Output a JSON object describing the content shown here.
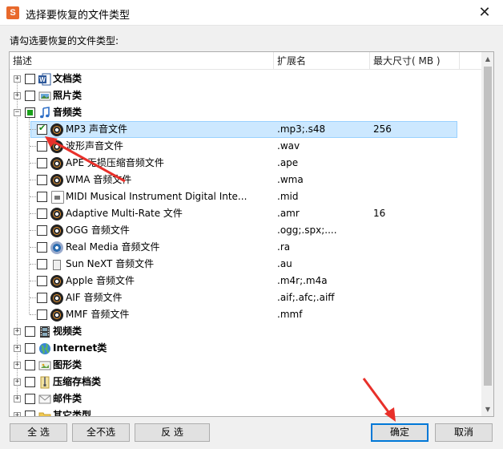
{
  "window": {
    "title": "选择要恢复的文件类型",
    "app_icon_letter": "S",
    "close_glyph": "✕"
  },
  "prompt": "请勾选要恢复的文件类型:",
  "columns": {
    "description": "描述",
    "extension": "扩展名",
    "max_size": "最大尺寸( MB )"
  },
  "tree": {
    "categories": [
      {
        "label": "文档类",
        "icon": "word-doc-icon",
        "expander": "+",
        "check_state": "unchecked"
      },
      {
        "label": "照片类",
        "icon": "photo-icon",
        "expander": "+",
        "check_state": "unchecked"
      },
      {
        "label": "音频类",
        "icon": "music-note-icon",
        "expander": "−",
        "check_state": "partial"
      },
      {
        "label": "视频类",
        "icon": "film-icon",
        "expander": "+",
        "check_state": "unchecked"
      },
      {
        "label": "Internet类",
        "icon": "globe-icon",
        "expander": "+",
        "check_state": "unchecked"
      },
      {
        "label": "图形类",
        "icon": "image-icon",
        "expander": "+",
        "check_state": "unchecked"
      },
      {
        "label": "压缩存档类",
        "icon": "archive-icon",
        "expander": "+",
        "check_state": "unchecked"
      },
      {
        "label": "邮件类",
        "icon": "envelope-icon",
        "expander": "+",
        "check_state": "unchecked"
      },
      {
        "label": "其它类型",
        "icon": "folder-icon",
        "expander": "+",
        "check_state": "unchecked"
      }
    ],
    "audio_items": [
      {
        "label": "MP3 声音文件",
        "ext": ".mp3;.s48",
        "size": "256",
        "checked": true,
        "selected": true,
        "icon": "audio-disc-icon"
      },
      {
        "label": "波形声音文件",
        "ext": ".wav",
        "size": "",
        "checked": false,
        "icon": "audio-disc-icon"
      },
      {
        "label": "APE 无损压缩音频文件",
        "ext": ".ape",
        "size": "",
        "checked": false,
        "icon": "audio-disc-icon"
      },
      {
        "label": "WMA 音频文件",
        "ext": ".wma",
        "size": "",
        "checked": false,
        "icon": "audio-disc-icon"
      },
      {
        "label": "MIDI Musical Instrument Digital Inte...",
        "ext": ".mid",
        "size": "",
        "checked": false,
        "icon": "midi-file-icon"
      },
      {
        "label": "Adaptive Multi-Rate 文件",
        "ext": ".amr",
        "size": "16",
        "checked": false,
        "icon": "audio-disc-icon"
      },
      {
        "label": "OGG 音频文件",
        "ext": ".ogg;.spx;....",
        "size": "",
        "checked": false,
        "icon": "audio-disc-icon"
      },
      {
        "label": "Real Media 音频文件",
        "ext": ".ra",
        "size": "",
        "checked": false,
        "icon": "realmedia-icon"
      },
      {
        "label": "Sun NeXT 音频文件",
        "ext": ".au",
        "size": "",
        "checked": false,
        "icon": "sun-file-icon"
      },
      {
        "label": "Apple 音频文件",
        "ext": ".m4r;.m4a",
        "size": "",
        "checked": false,
        "icon": "audio-disc-icon"
      },
      {
        "label": "AIF 音频文件",
        "ext": ".aif;.afc;.aiff",
        "size": "",
        "checked": false,
        "icon": "audio-disc-icon"
      },
      {
        "label": "MMF 音频文件",
        "ext": ".mmf",
        "size": "",
        "checked": false,
        "icon": "audio-disc-icon"
      }
    ]
  },
  "buttons": {
    "select_all": "全 选",
    "select_none": "全不选",
    "invert": "反 选",
    "ok": "确定",
    "cancel": "取消"
  },
  "colors": {
    "selection": "#cce8ff",
    "annotation_arrow": "#e8302a",
    "default_button_border": "#0078d7"
  }
}
